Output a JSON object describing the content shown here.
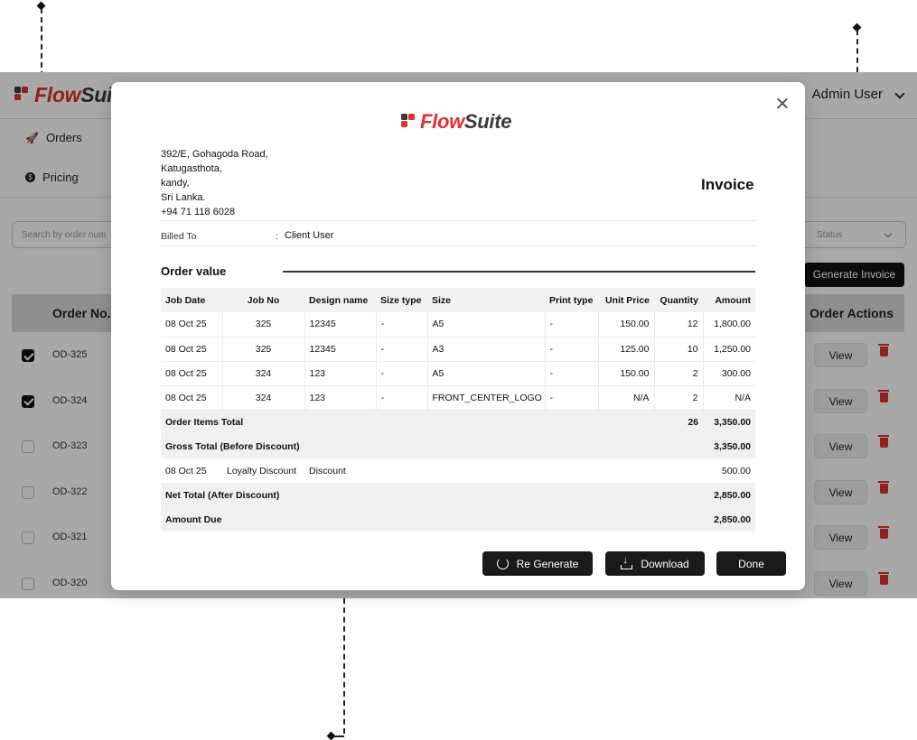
{
  "app": {
    "brand_part1": "Flow",
    "brand_part2": "Suite",
    "user_menu_label": "Admin User",
    "nav_orders": "Orders",
    "nav_pricing": "Pricing",
    "search_placeholder": "Search by order num",
    "status_placeholder": "Status",
    "generate_invoice_label": "Generate Invoice",
    "col_order_no": "Order No.",
    "col_order_actions": "Order Actions",
    "view_label": "View",
    "rows": [
      {
        "order": "OD-325",
        "checked": true
      },
      {
        "order": "OD-324",
        "checked": true
      },
      {
        "order": "OD-323",
        "checked": false
      },
      {
        "order": "OD-322",
        "checked": false
      },
      {
        "order": "OD-321",
        "checked": false
      },
      {
        "order": "OD-320",
        "checked": false
      }
    ]
  },
  "colors": {
    "brand_red": "#e03131",
    "brand_dark": "#3b3b3b",
    "button_dark": "#1a1a1a"
  },
  "modal": {
    "brand_part1": "Flow",
    "brand_part2": "Suite",
    "address": [
      "392/E, Gohagoda Road,",
      "Katugasthota,",
      "kandy,",
      "Sri Lanka.",
      "+94 71 118 6028"
    ],
    "title": "Invoice",
    "billed_to_label": "Billed To",
    "billed_to_sep": ":",
    "billed_to_value": "Client User",
    "order_value_title": "Order value",
    "columns": [
      "Job Date",
      "Job No",
      "Design name",
      "Size type",
      "Size",
      "Print type",
      "Unit Price",
      "Quantity",
      "Amount"
    ],
    "items": [
      [
        "08 Oct 25",
        "325",
        "12345",
        "-",
        "A5",
        "-",
        "150.00",
        "12",
        "1,800.00"
      ],
      [
        "08 Oct 25",
        "325",
        "12345",
        "-",
        "A3",
        "-",
        "125.00",
        "10",
        "1,250.00"
      ],
      [
        "08 Oct 25",
        "324",
        "123",
        "-",
        "A5",
        "-",
        "150.00",
        "2",
        "300.00"
      ],
      [
        "08 Oct 25",
        "324",
        "123",
        "-",
        "FRONT_CENTER_LOGO",
        "-",
        "N/A",
        "2",
        "N/A"
      ]
    ],
    "items_total_label": "Order Items Total",
    "items_total_qty": "26",
    "items_total_amount": "3,350.00",
    "gross_label": "Gross Total (Before Discount)",
    "gross_amount": "3,350.00",
    "discount_date": "08 Oct 25",
    "discount_name": "Loyalty Discount",
    "discount_type": "Discount",
    "discount_amount": "500.00",
    "net_label": "Net Total (After Discount)",
    "net_amount": "2,850.00",
    "due_label": "Amount Due",
    "due_amount": "2,850.00",
    "regenerate_label": "Re Generate",
    "download_label": "Download",
    "done_label": "Done"
  }
}
